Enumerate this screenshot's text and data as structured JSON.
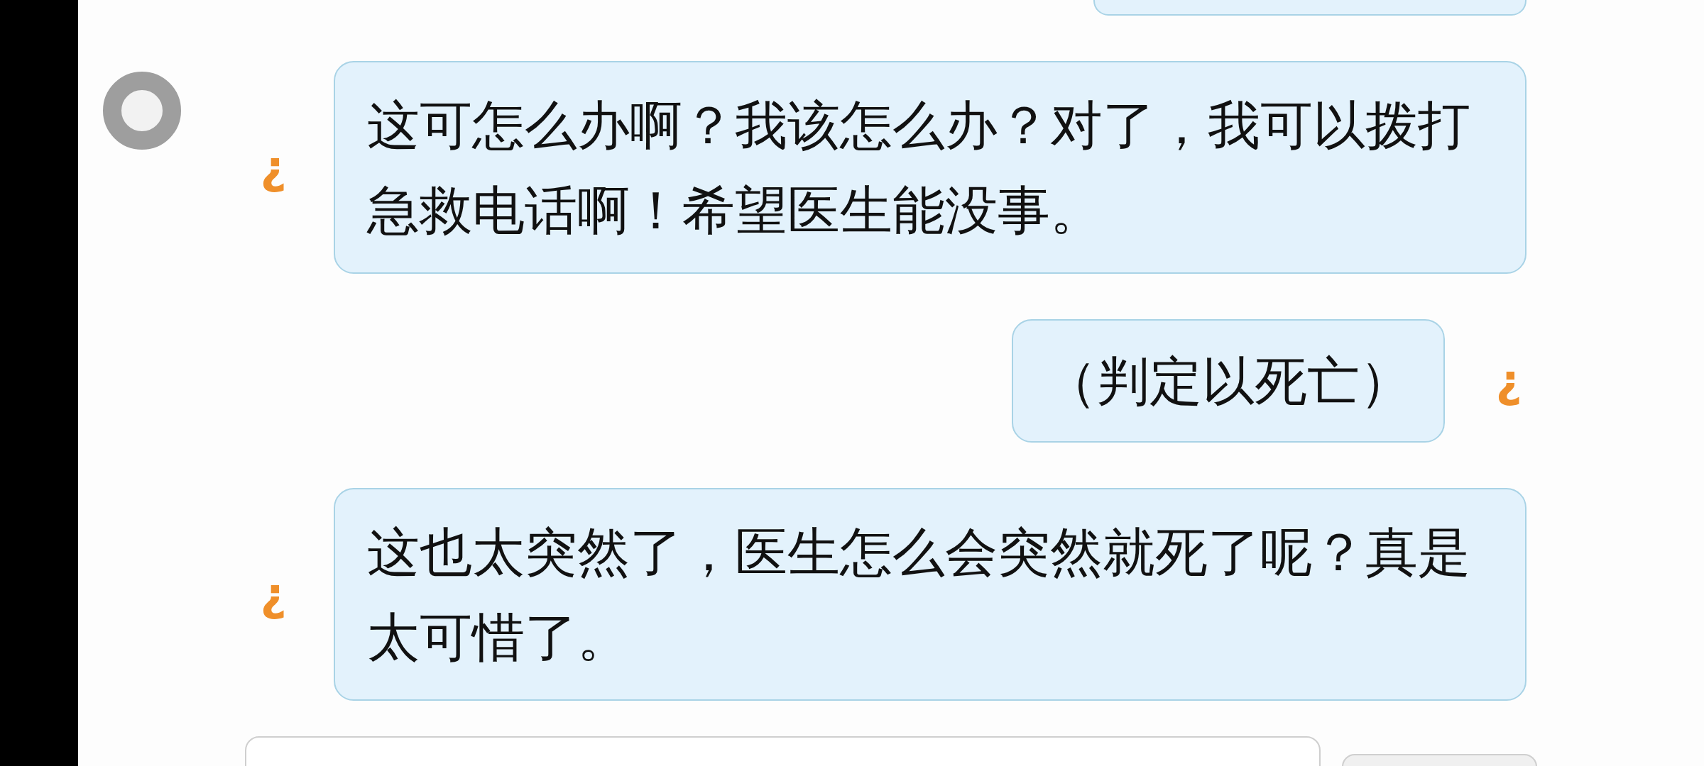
{
  "messages": [
    {
      "kind": "outgoing",
      "avatar": false
    },
    {
      "kind": "incoming",
      "avatar": true,
      "icon": "¿",
      "text": "这可怎么办啊？我该怎么办？对了，我可以拨打急救电话啊！希望医生能没事。"
    },
    {
      "kind": "outgoing",
      "avatar": false,
      "icon": "¿",
      "text": "（判定以死亡）"
    },
    {
      "kind": "incoming",
      "avatar": false,
      "icon": "¿",
      "text": "这也太突然了，医生怎么会突然就死了呢？真是太可惜了。"
    }
  ],
  "composer": {
    "has_input": true,
    "has_send_button": true
  }
}
